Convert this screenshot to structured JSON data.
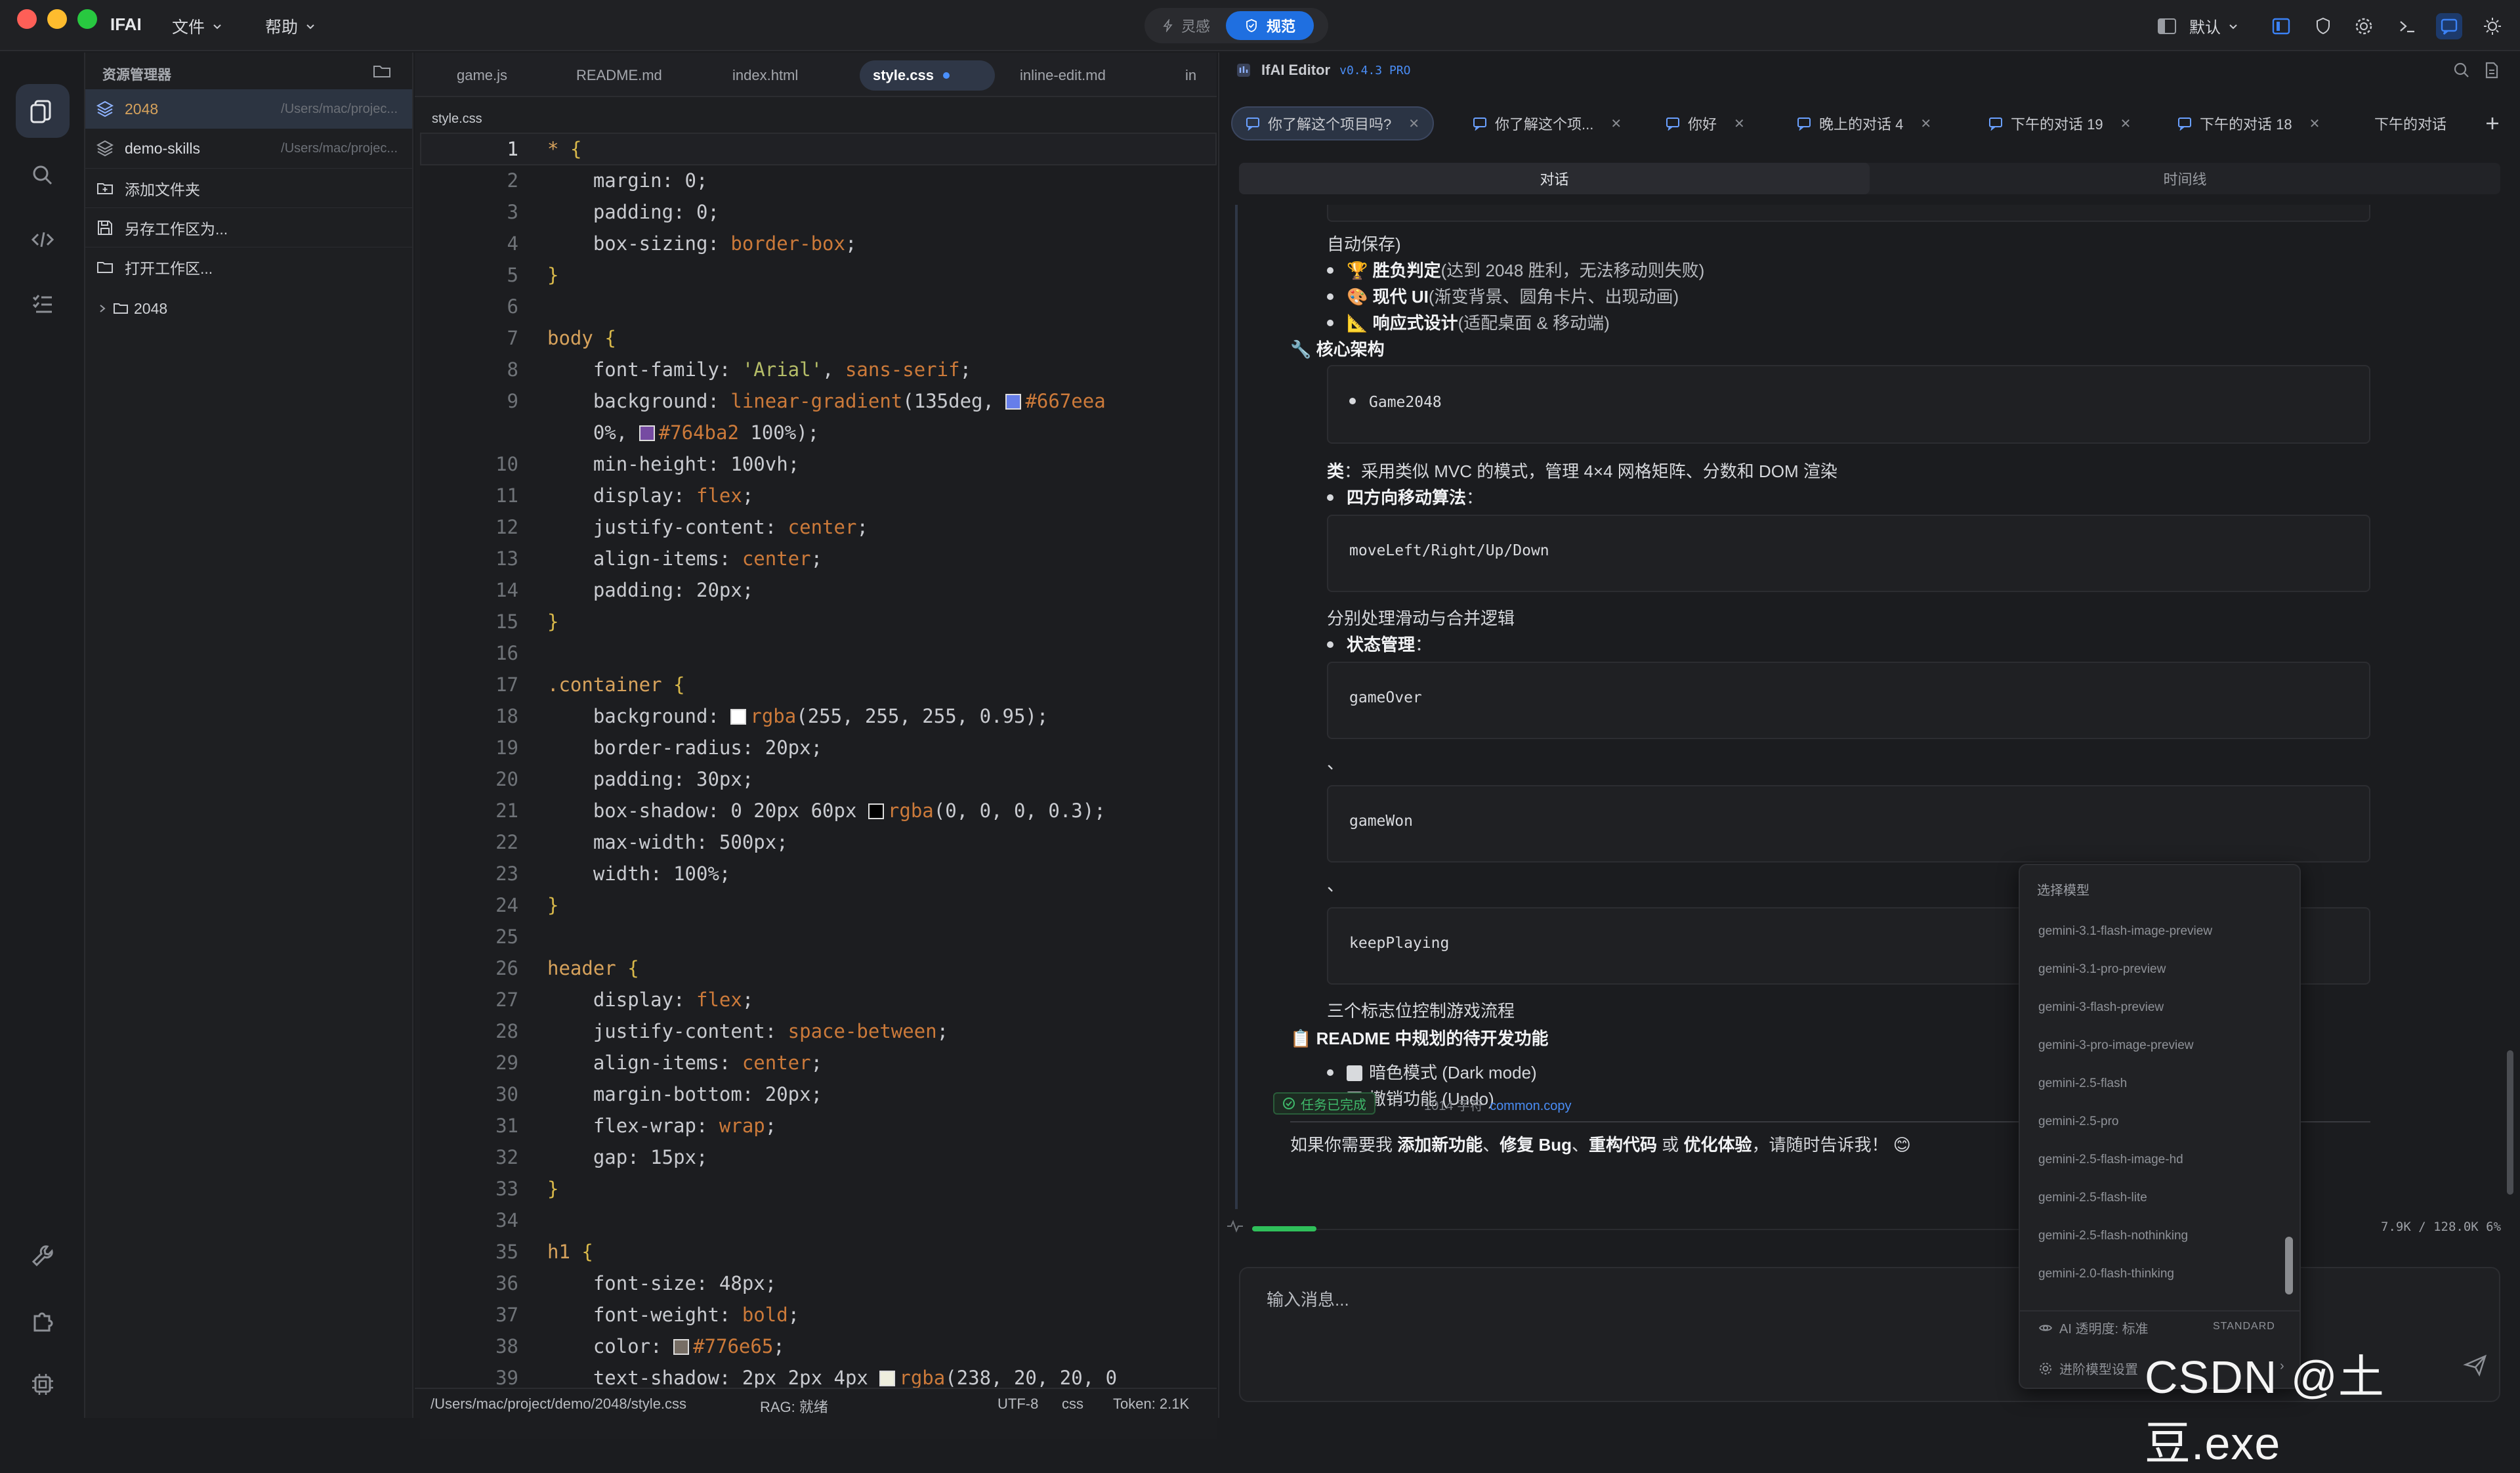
{
  "titlebar": {
    "app": "IFAI",
    "menu_file": "文件",
    "menu_help": "帮助",
    "mode_ling": "灵感",
    "mode_guifan": "规范",
    "profile": "默认"
  },
  "explorer": {
    "title": "资源管理器",
    "workspaces": [
      {
        "name": "2048",
        "path": "/Users/mac/projec..."
      },
      {
        "name": "demo-skills",
        "path": "/Users/mac/projec..."
      }
    ],
    "actions": [
      "添加文件夹",
      "另存工作区为...",
      "打开工作区..."
    ],
    "tree_root": "2048"
  },
  "editor": {
    "tabs": [
      "game.js",
      "README.md",
      "index.html",
      "style.css",
      "inline-edit.md",
      "in"
    ],
    "active_tab": "style.css",
    "breadcrumb": "style.css",
    "line_numbers": [
      "1",
      "2",
      "3",
      "4",
      "5",
      "6",
      "7",
      "8",
      "9",
      "",
      "10",
      "11",
      "12",
      "13",
      "14",
      "15",
      "16",
      "17",
      "18",
      "19",
      "20",
      "21",
      "22",
      "23",
      "24",
      "25",
      "26",
      "27",
      "28",
      "29",
      "30",
      "31",
      "32",
      "33",
      "34",
      "35",
      "36",
      "37",
      "38",
      "39"
    ],
    "status": {
      "path": "/Users/mac/project/demo/2048/style.css",
      "rag": "RAG: 就绪",
      "encoding": "UTF-8",
      "language": "css",
      "tokens": "Token: 2.1K"
    }
  },
  "chat": {
    "title": "IfAI Editor",
    "version": "v0.4.3 PRO",
    "tabs": [
      "你了解这个项目吗?",
      "你了解这个项...",
      "你好",
      "晚上的对话 4",
      "下午的对话 19",
      "下午的对话 18",
      "下午的对话"
    ],
    "segments": [
      "对话",
      "时间线"
    ],
    "messages": {
      "l1": "自动保存)",
      "l2_b": "胜负判定",
      "l2_r": "(达到 2048 胜利，无法移动则失败)",
      "l3_b": "现代 UI",
      "l3_r": "(渐变背景、圆角卡片、出现动画)",
      "l4_b": "响应式设计",
      "l4_r": "(适配桌面 & 移动端)",
      "h_core": "核心架构",
      "code_game": "Game2048",
      "l5_b": "类",
      "l5_r": "：采用类似 MVC 的模式，管理 4×4 网格矩阵、分数和 DOM 渲染",
      "l6_b": "四方向移动算法",
      "l6_r": "：",
      "code_move": "moveLeft/Right/Up/Down",
      "l7": "分别处理滑动与合并逻辑",
      "l8_b": "状态管理",
      "l8_r": "：",
      "code_over": "gameOver",
      "sep1": "、",
      "code_won": "gameWon",
      "sep2": "、",
      "code_keep": "keepPlaying",
      "l9": "三个标志位控制游戏流程",
      "h_readme": "README 中规划的待开发功能",
      "todo1": "暗色模式 (Dark mode)",
      "todo2": "撤销功能 (Undo)",
      "final_a": "如果你需要我 ",
      "final_b1": "添加新功能",
      "final_s1": "、",
      "final_b2": "修复 Bug",
      "final_s2": "、",
      "final_b3": "重构代码",
      "final_s3": " 或 ",
      "final_b4": "优化体验",
      "final_c": "，请随时告诉我！ 😊"
    },
    "done_badge": "任务已完成",
    "char_count": "1014 字符",
    "copy_link": "common.copy",
    "token_info": "7.9K / 128.0K 6%",
    "input_placeholder": "输入消息...",
    "progress_fraction": 0.07
  },
  "dropdown": {
    "title": "选择模型",
    "models": [
      "gemini-3.1-flash-image-preview",
      "gemini-3.1-pro-preview",
      "gemini-3-flash-preview",
      "gemini-3-pro-image-preview",
      "gemini-2.5-flash",
      "gemini-2.5-pro",
      "gemini-2.5-flash-image-hd",
      "gemini-2.5-flash-lite",
      "gemini-2.5-flash-nothinking",
      "gemini-2.0-flash-thinking"
    ],
    "ai_transparency": "AI 透明度: 标准",
    "standard": "STANDARD",
    "advanced": "进阶模型设置"
  },
  "watermark": "CSDN @土豆.exe",
  "colors": {
    "accent": "#1f6fe0",
    "success": "#2fbf5a",
    "bg": "#1b1c1f"
  }
}
